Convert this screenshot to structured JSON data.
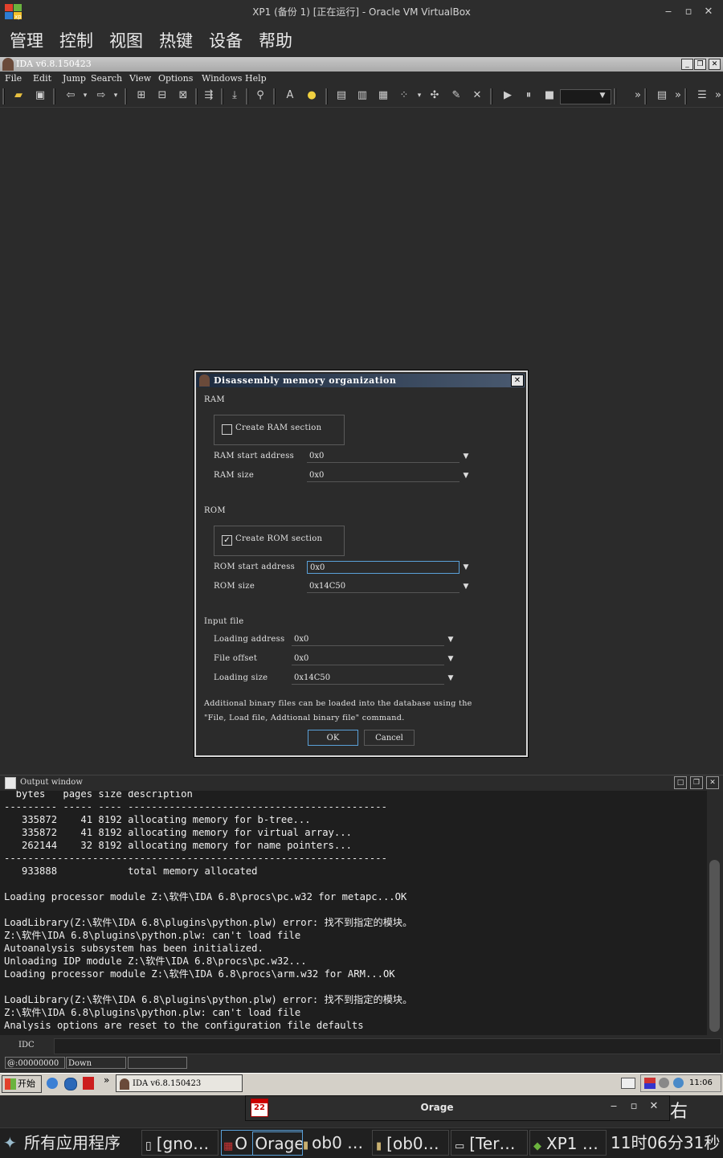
{
  "vbox": {
    "title": "XP1 (备份 1) [正在运行] - Oracle VM VirtualBox",
    "menu": [
      "管理",
      "控制",
      "视图",
      "热键",
      "设备",
      "帮助"
    ]
  },
  "ida": {
    "title": "IDA v6.8.150423",
    "menu": [
      "File",
      "Edit",
      "Jump",
      "Search",
      "View",
      "Options",
      "Windows",
      "Help"
    ]
  },
  "dialog": {
    "title": "Disassembly memory organization",
    "ram_group": "RAM",
    "create_ram_label": "Create RAM section",
    "create_ram_checked": false,
    "ram_start_label": "RAM start address",
    "ram_start_value": "0x0",
    "ram_size_label": "RAM size",
    "ram_size_value": "0x0",
    "rom_group": "ROM",
    "create_rom_label": "Create ROM section",
    "create_rom_checked": true,
    "rom_start_label": "ROM start address",
    "rom_start_value": "0x0",
    "rom_size_label": "ROM size",
    "rom_size_value": "0x14C50",
    "input_group": "Input file",
    "loading_address_label": "Loading address",
    "loading_address_value": "0x0",
    "file_offset_label": "File offset",
    "file_offset_value": "0x0",
    "loading_size_label": "Loading size",
    "loading_size_value": "0x14C50",
    "note_line1": "Additional binary files can be loaded into the database using the",
    "note_line2": "\"File, Load file, Addtional binary file\" command.",
    "ok": "OK",
    "cancel": "Cancel"
  },
  "output": {
    "title": "Output window",
    "lines": [
      "  bytes   pages size description",
      "--------- ----- ---- --------------------------------------------",
      "   335872    41 8192 allocating memory for b-tree...",
      "   335872    41 8192 allocating memory for virtual array...",
      "   262144    32 8192 allocating memory for name pointers...",
      "-----------------------------------------------------------------",
      "   933888            total memory allocated",
      "",
      "Loading processor module Z:\\软件\\IDA 6.8\\procs\\pc.w32 for metapc...OK",
      "",
      "LoadLibrary(Z:\\软件\\IDA 6.8\\plugins\\python.plw) error: 找不到指定的模块。",
      "Z:\\软件\\IDA 6.8\\plugins\\python.plw: can't load file",
      "Autoanalysis subsystem has been initialized.",
      "Unloading IDP module Z:\\软件\\IDA 6.8\\procs\\pc.w32...",
      "Loading processor module Z:\\软件\\IDA 6.8\\procs\\arm.w32 for ARM...OK",
      "",
      "LoadLibrary(Z:\\软件\\IDA 6.8\\plugins\\python.plw) error: 找不到指定的模块。",
      "Z:\\软件\\IDA 6.8\\plugins\\python.plw: can't load file",
      "Analysis options are reset to the configuration file defaults"
    ],
    "idc_label": "IDC"
  },
  "status": {
    "address": "@:00000000",
    "direction": "Down",
    "extra": ""
  },
  "xp_taskbar": {
    "start": "开始",
    "chevron": "»",
    "task_ida": "IDA v6.8.150423",
    "clock": "11:06"
  },
  "orage": {
    "title": "Orage",
    "icon_day": "22",
    "right_ctrl": "右 Ctrl"
  },
  "host_panel": {
    "apps_menu": "所有应用程序",
    "tasks": [
      "[gno…",
      "O",
      "Orage",
      "ob0 …",
      "[ob0…",
      "[Ter…",
      "XP1 …"
    ],
    "clock": "11时06分31秒"
  },
  "colors": {
    "dialog_title_bg": "#1d2b3f",
    "xp_taskbar_bg": "#d4d0c8",
    "output_bg": "#1e1e1e"
  }
}
